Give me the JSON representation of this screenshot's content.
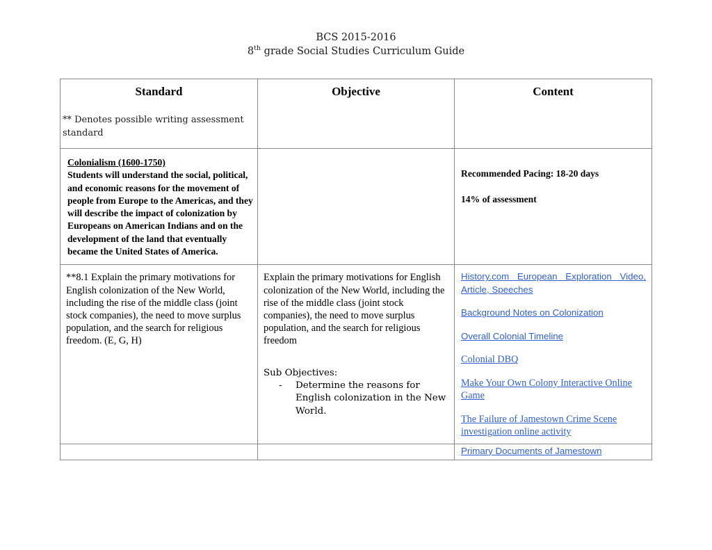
{
  "document": {
    "title_line1": "BCS 2015-2016",
    "title_grade_number": "8",
    "title_grade_suffix": "th",
    "title_line2_rest": " grade Social Studies Curriculum Guide"
  },
  "table": {
    "headers": {
      "standard": "Standard",
      "objective": "Objective",
      "content": "Content"
    },
    "header_note": "** Denotes possible writing assessment standard",
    "rows": [
      {
        "standard_heading": "Colonialism (1600-1750)",
        "standard_body": "Students will understand the social, political, and economic reasons for the movement of  people from Europe to the Americas, and they will describe the impact of colonization by Europeans on American Indians and on the development of the land that eventually became  the United States of America.",
        "objective": "",
        "content_pacing": "Recommended Pacing: 18-20 days",
        "content_assessment": "14% of assessment"
      },
      {
        "standard": "**8.1 Explain the primary motivations for English colonization of the New World, including the rise of the middle class (joint stock companies), the need to move surplus population, and the search for religious freedom. (E, G, H)",
        "objective_main": "Explain the primary motivations for English colonization of the New World, including the rise of the middle class (joint stock companies), the need to move surplus population, and the search for religious freedom",
        "sub_objectives_label": "Sub Objectives:",
        "sub_objectives": [
          {
            "dash": "-",
            "text": "Determine the reasons for English colonization in the New World."
          }
        ],
        "content_links": [
          {
            "label": "History.com    European    Exploration Video, Article, Speeches",
            "style": "sans-justify"
          },
          {
            "label": "Background Notes on Colonization",
            "style": "sans"
          },
          {
            "label": "Overall Colonial Timeline",
            "style": "sans"
          },
          {
            "label": "Colonial DBQ",
            "style": "serif"
          },
          {
            "label": "Make Your Own Colony Interactive Online Game",
            "style": "serif"
          },
          {
            "label": "The Failure of Jamestown Crime Scene investigation online activity",
            "style": "serif"
          }
        ]
      },
      {
        "standard": "",
        "objective": "",
        "content_links": [
          {
            "label": "Primary Documents of Jamestown",
            "style": "sans"
          }
        ]
      }
    ]
  },
  "colors": {
    "link": "#3060cf",
    "border": "#888888",
    "text": "#000000"
  }
}
